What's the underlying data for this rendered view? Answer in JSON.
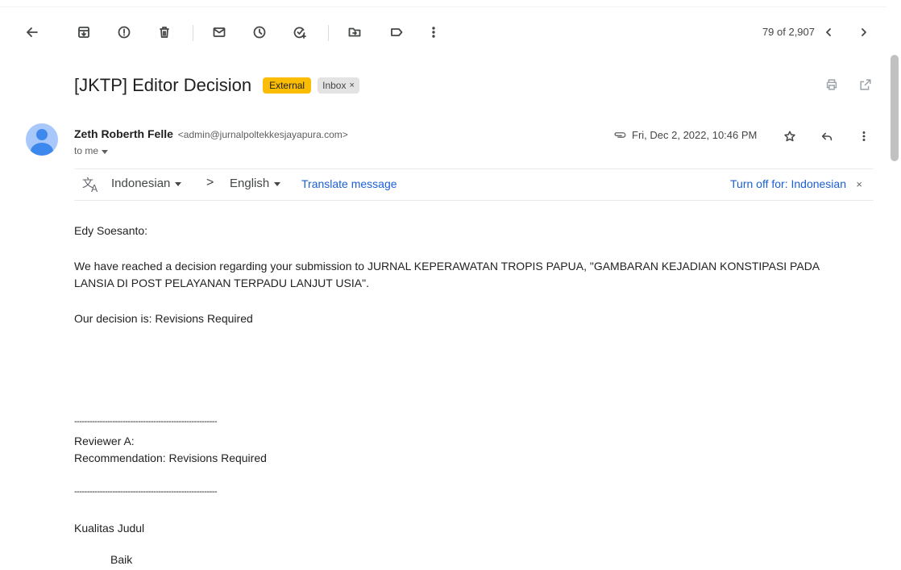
{
  "toolbar": {
    "icons": [
      "back-arrow-icon",
      "archive-icon",
      "report-spam-icon",
      "delete-icon",
      "mark-unread-icon",
      "snooze-icon",
      "add-task-icon",
      "move-to-icon",
      "label-icon",
      "more-vert-icon"
    ],
    "pager": "79 of 2,907"
  },
  "email": {
    "subject": "[JKTP] Editor Decision",
    "chips": {
      "external": "External",
      "inbox": "Inbox",
      "inbox_close": "×"
    },
    "sender_name": "Zeth Roberth Felle",
    "sender_email": "<admin@jurnalpoltekkesjayapura.com>",
    "to": "to me",
    "date": "Fri, Dec 2, 2022, 10:46 PM"
  },
  "translate": {
    "from": "Indonesian",
    "arrow": ">",
    "to": "English",
    "link": "Translate message",
    "turn_off": "Turn off for: Indonesian",
    "close": "×"
  },
  "body": {
    "greeting": "Edy Soesanto:",
    "para1_line1": "We have reached a decision regarding your submission to JURNAL KEPERAWATAN TROPIS PAPUA, \"GAMBARAN KEJADIAN KONSTIPASI PADA",
    "para1_line2": "LANSIA DI POST PELAYANAN TERPADU LANJUT USIA\".",
    "decision": "Our decision is: Revisions Required",
    "divider": "--------------------------------------------------------",
    "reviewer": "Reviewer A:",
    "recommendation": "Recommendation: Revisions Required",
    "divider2": "--------------------------------------------------------",
    "section1": "Kualitas Judul",
    "section1_value": "Baik"
  },
  "colors": {
    "external_chip": "#fbbc04",
    "inbox_chip": "#e3e3e3",
    "link": "#1a5fd6",
    "avatar_bg": "#a8c7fa"
  }
}
